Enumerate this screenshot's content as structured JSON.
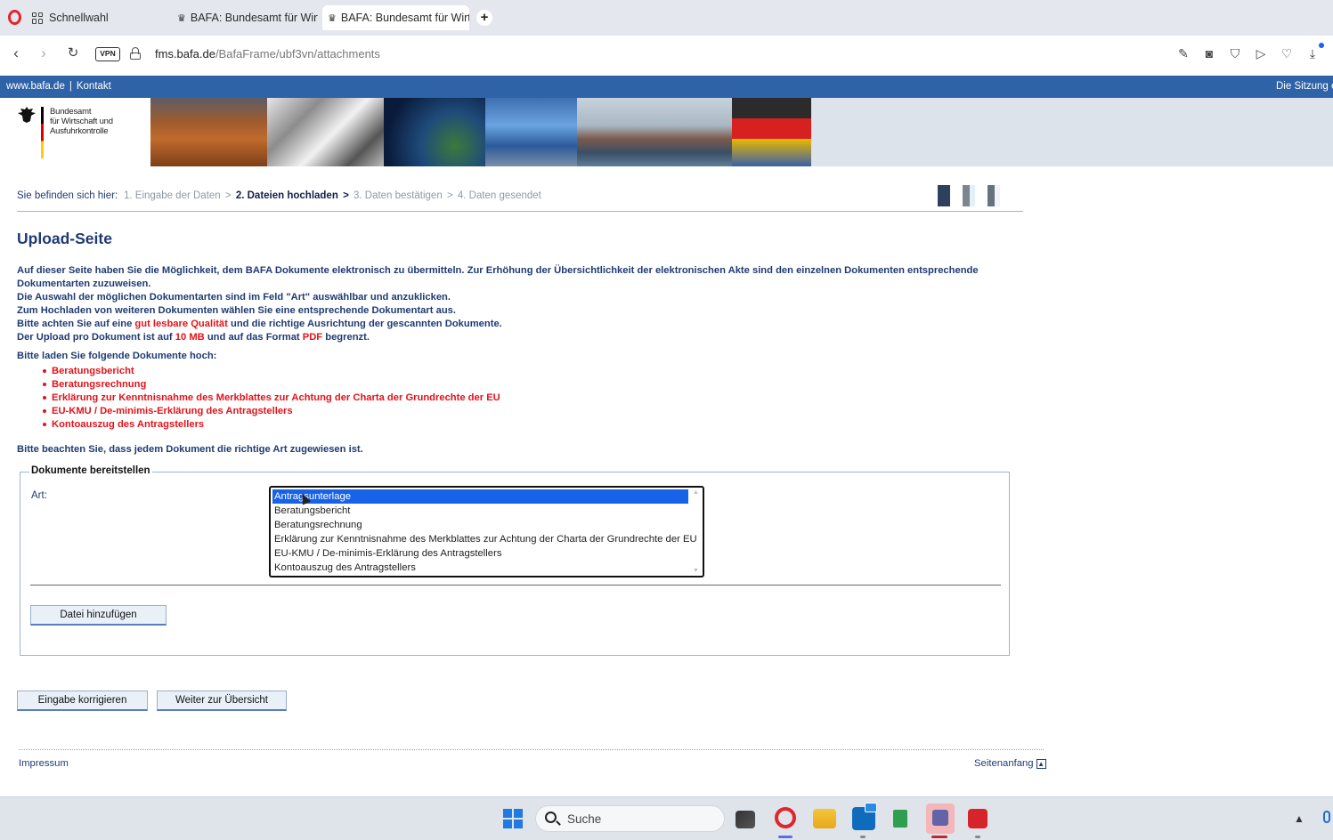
{
  "browser": {
    "tabs": [
      {
        "label": "Schnellwahl"
      },
      {
        "label": "BAFA: Bundesamt für Wirt"
      },
      {
        "label": "BAFA: Bundesamt für Wirt"
      }
    ],
    "vpn_label": "VPN",
    "url_host": "fms.bafa.de",
    "url_path": "/BafaFrame/ubf3vn/attachments"
  },
  "header": {
    "link_home": "www.bafa.de",
    "separator": "|",
    "link_contact": "Kontakt",
    "session_text": "Die Sitzung e",
    "logo_lines": [
      "Bundesamt",
      "für Wirtschaft und",
      "Ausfuhrkontrolle"
    ]
  },
  "breadcrumb": {
    "label": "Sie befinden sich hier:",
    "steps": [
      {
        "text": "1. Eingabe der Daten",
        "active": false
      },
      {
        "text": "2. Dateien hochladen",
        "active": true
      },
      {
        "text": "3. Daten bestätigen",
        "active": false
      },
      {
        "text": "4. Daten gesendet",
        "active": false
      }
    ],
    "separator": ">",
    "size_box_colors": [
      "#2f3f5e",
      "#7c868f",
      "#66737e"
    ]
  },
  "page": {
    "title": "Upload-Seite",
    "intro": {
      "line1": "Auf dieser Seite haben Sie die Möglichkeit, dem BAFA Dokumente elektronisch zu übermitteln. Zur Erhöhung der Übersichtlichkeit der elektronischen Akte sind den einzelnen Dokumenten entsprechende Dokumentarten zuzuweisen.",
      "line2": "Die Auswahl der möglichen Dokumentarten sind im Feld \"Art\" auswählbar und anzuklicken.",
      "line3": "Zum Hochladen von weiteren Dokumenten wählen Sie eine entsprechende Dokumentart aus.",
      "line4_a": "Bitte achten Sie auf eine ",
      "line4_red": "gut lesbare Qualität",
      "line4_b": " und die richtige Ausrichtung der gescannten Dokumente.",
      "line5_a": "Der Upload pro Dokument ist auf ",
      "line5_red1": "10 MB",
      "line5_b": " und auf das Format ",
      "line5_red2": "PDF",
      "line5_c": " begrenzt."
    },
    "required_title": "Bitte laden Sie folgende Dokumente hoch:",
    "required_docs": [
      "Beratungsbericht",
      "Beratungsrechnung",
      "Erklärung zur Kenntnisnahme des Merkblattes zur Achtung der Charta der Grundrechte der EU",
      "EU-KMU / De-minimis-Erklärung des Antragstellers",
      "Kontoauszug des Antragstellers"
    ],
    "note": "Bitte beachten Sie, dass jedem Dokument die richtige Art zugewiesen ist."
  },
  "upload_form": {
    "legend": "Dokumente bereitstellen",
    "art_label": "Art:",
    "options": [
      "Antragsunterlage",
      "Beratungsbericht",
      "Beratungsrechnung",
      "Erklärung zur Kenntnisnahme des Merkblattes zur Achtung der Charta der Grundrechte der EU",
      "EU-KMU / De-minimis-Erklärung des Antragstellers",
      "Kontoauszug des Antragstellers"
    ],
    "selected_option": "Antragsunterlage",
    "add_file_button": "Datei hinzufügen"
  },
  "actions": {
    "correct_button": "Eingabe korrigieren",
    "next_button": "Weiter zur Übersicht"
  },
  "footer": {
    "impressum": "Impressum",
    "top_link": "Seitenanfang"
  },
  "taskbar": {
    "search_placeholder": "Suche",
    "apps": [
      "start-icon",
      "taskview-icon",
      "opera-icon",
      "file-explorer-icon",
      "outlook-icon",
      "excel-icon",
      "teams-icon",
      "acrobat-icon"
    ],
    "accent_colors": {
      "opera": "#e0262c",
      "windows": "#1f7be0",
      "selection": "#1763e8",
      "header_blue": "#2f63a8",
      "warning_red": "#e3121a"
    }
  }
}
